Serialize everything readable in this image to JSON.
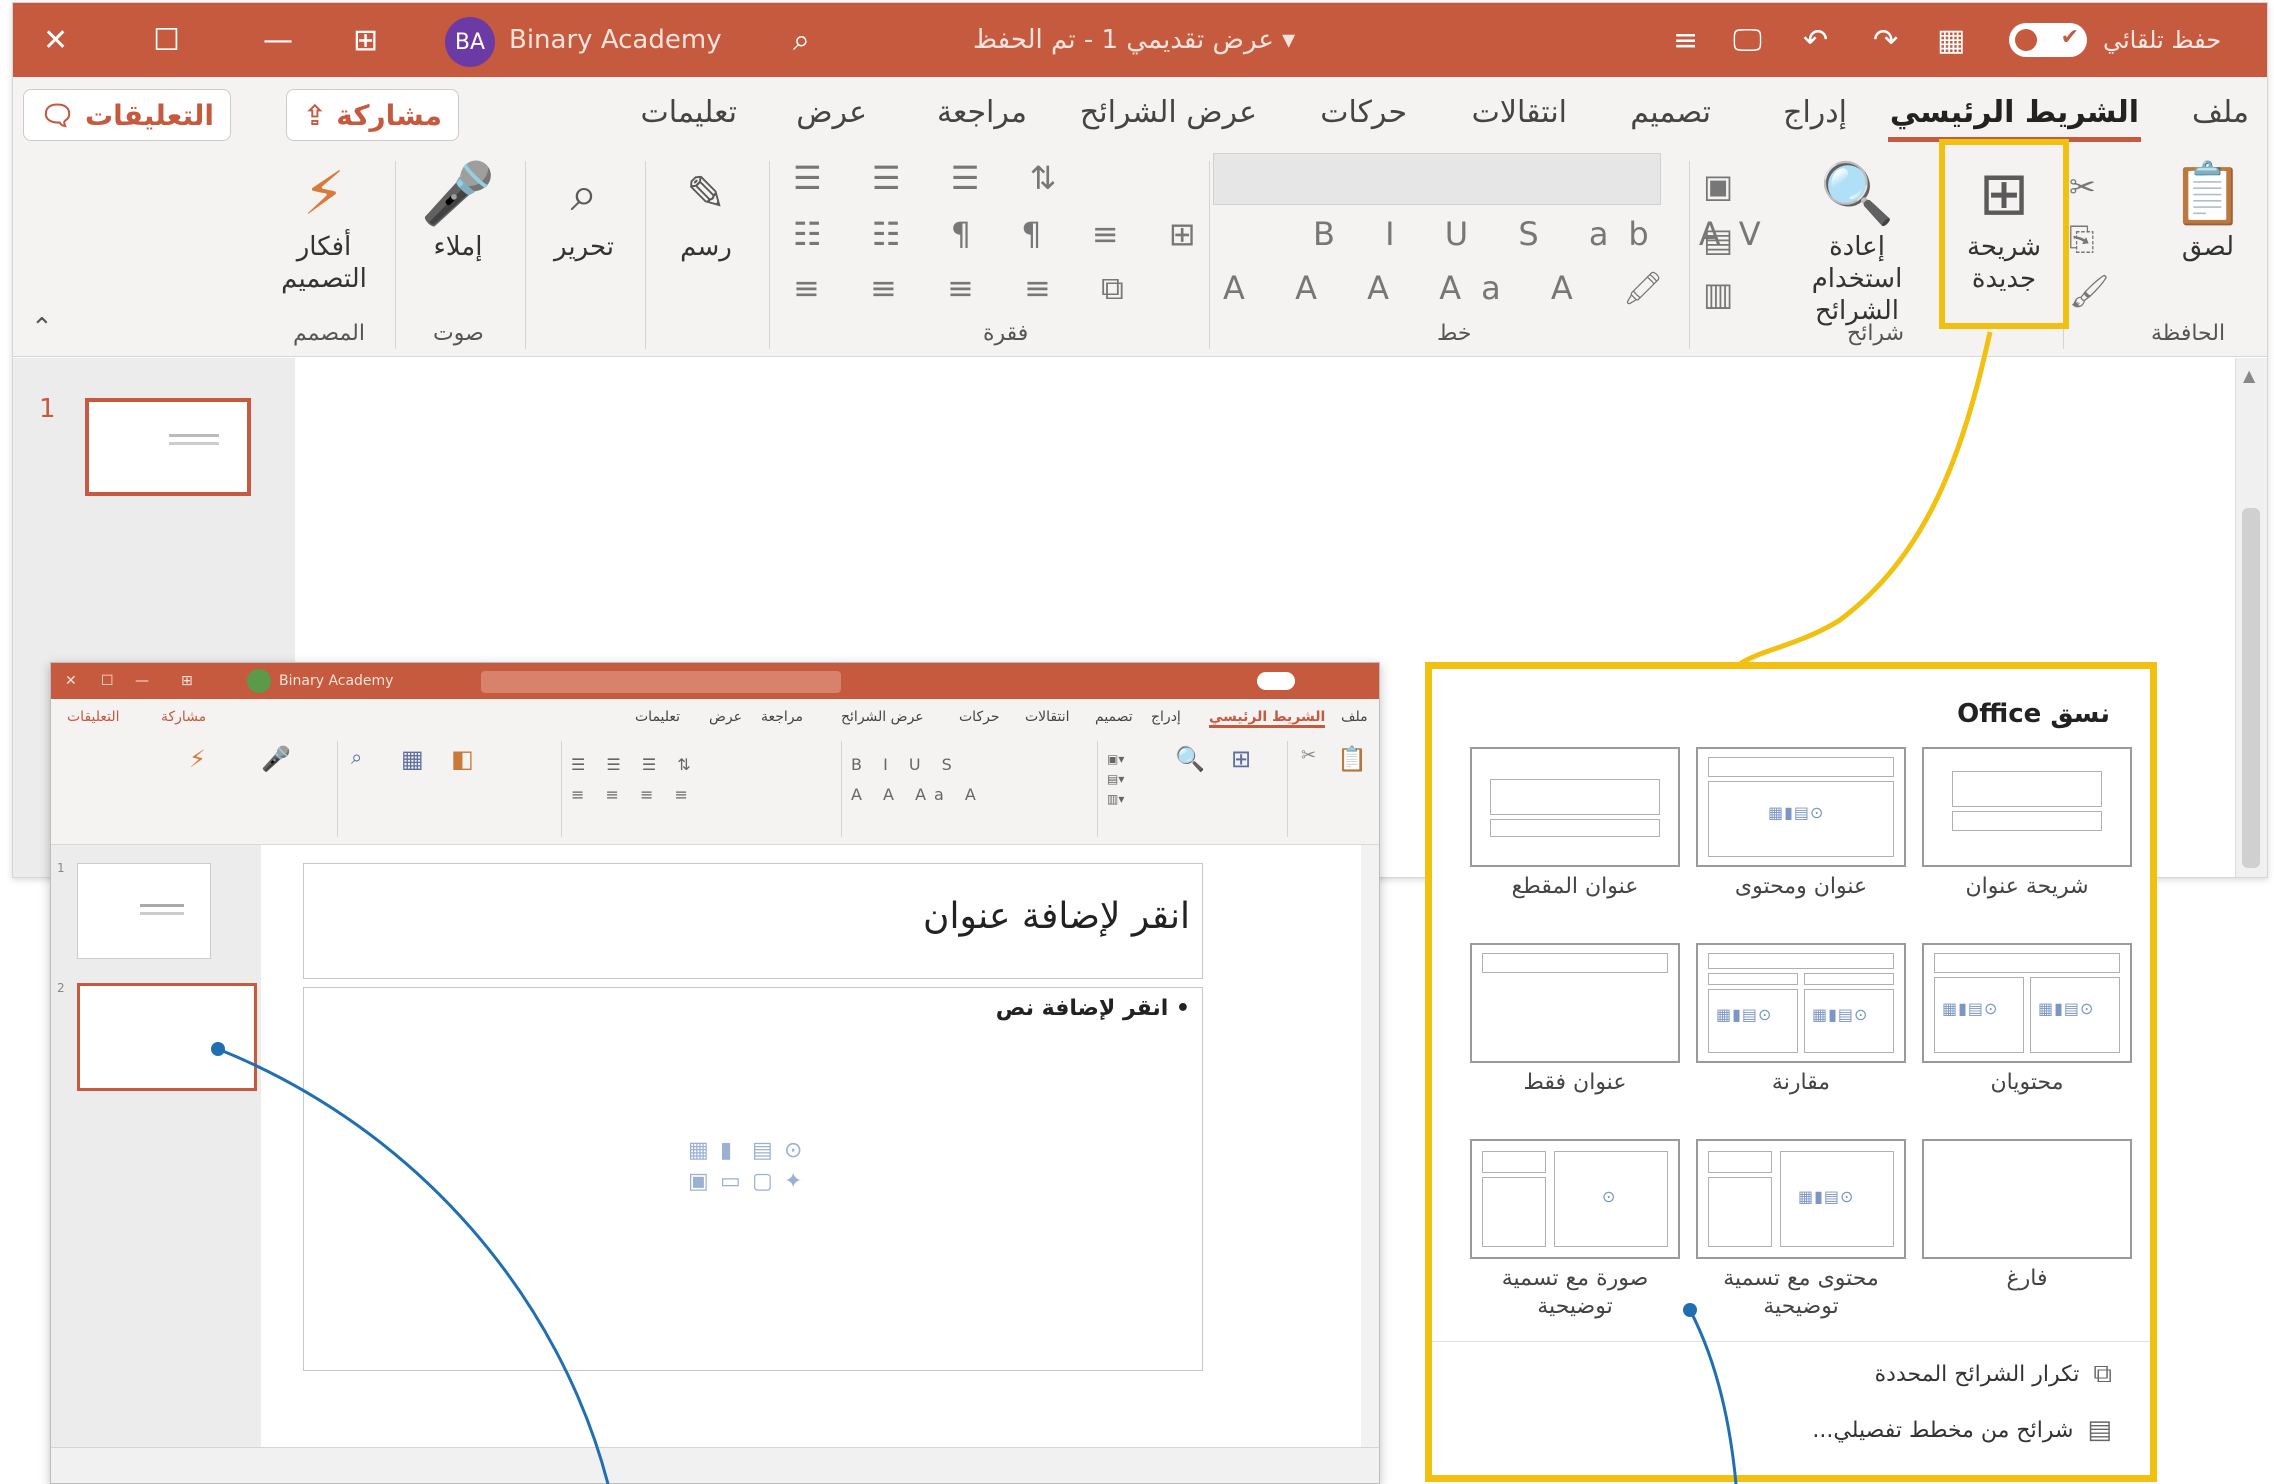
{
  "main_window": {
    "title": "عرض تقديمي 1 - تم الحفظ",
    "user": {
      "initials": "BA",
      "name": "Binary Academy"
    },
    "autosave_label": "حفظ تلقائي",
    "tabs": [
      "ملف",
      "الشريط الرئيسي",
      "إدراج",
      "تصميم",
      "انتقالات",
      "حركات",
      "عرض الشرائح",
      "مراجعة",
      "عرض",
      "تعليمات"
    ],
    "active_tab": "الشريط الرئيسي",
    "share_label": "مشاركة",
    "comments_label": "التعليقات",
    "ribbon": {
      "paste_label": "لصق",
      "new_slide_label": "شريحة جديدة",
      "reuse_slides_label": "إعادة استخدام الشرائح",
      "draw_label": "رسم",
      "edit_label": "تحرير",
      "dictate_label": "إملاء",
      "design_ideas_label": "أفكار التصميم",
      "groups": {
        "clipboard": "الحافظة",
        "slides": "شرائح",
        "font": "خط",
        "paragraph": "فقرة",
        "voice": "صوت",
        "designer": "المصمم"
      }
    },
    "slide_number": "1"
  },
  "inset_window": {
    "user_name": "Binary Academy",
    "title_placeholder": "انقر لإضافة عنوان",
    "content_placeholder": "انقر لإضافة نص",
    "tabs": [
      "ملف",
      "الشريط الرئيسي",
      "إدراج",
      "تصميم",
      "انتقالات",
      "حركات",
      "عرض الشرائح",
      "مراجعة",
      "عرض",
      "تعليمات"
    ],
    "share_label": "مشاركة",
    "comments_label": "التعليقات",
    "slide_numbers": [
      "1",
      "2"
    ]
  },
  "layout_gallery": {
    "heading": "نسق Office",
    "layouts": [
      "شريحة عنوان",
      "عنوان ومحتوى",
      "عنوان المقطع",
      "محتويان",
      "مقارنة",
      "عنوان فقط",
      "فارغ",
      "محتوى مع تسمية توضيحية",
      "صورة مع تسمية توضيحية"
    ],
    "commands": [
      "تكرار الشرائح المحددة",
      "شرائح من مخطط تفصيلي..."
    ]
  },
  "colors": {
    "accent": "#c55a3f",
    "highlight": "#f2c010",
    "callout_line": "#1f6fb2"
  }
}
